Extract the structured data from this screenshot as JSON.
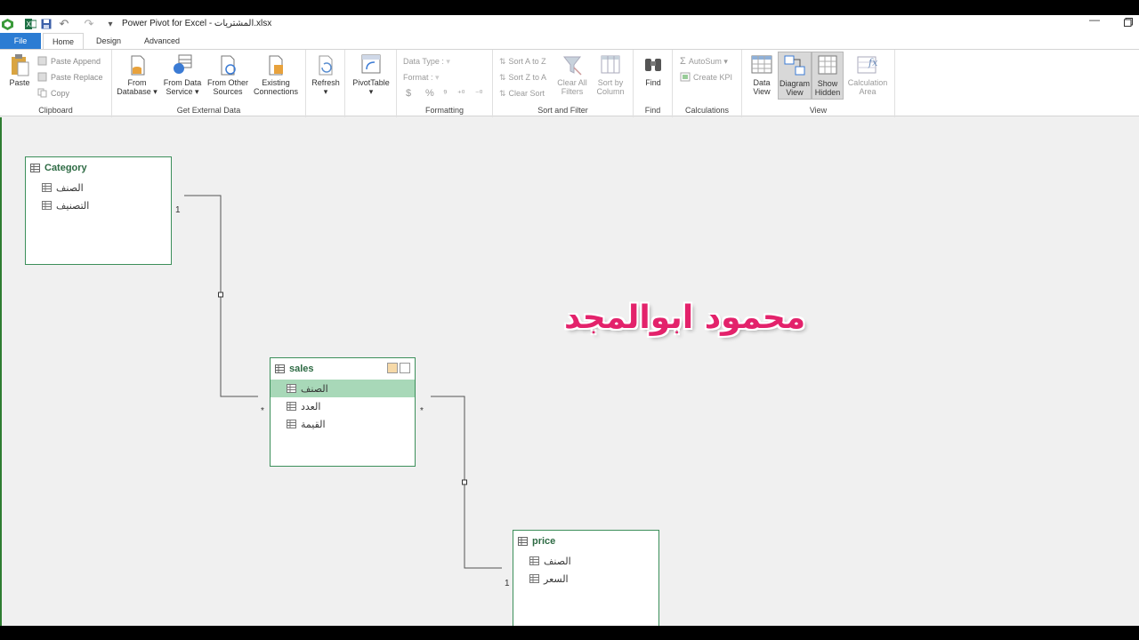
{
  "titlebar": {
    "title": "Power Pivot for Excel - المشتريات.xlsx",
    "qa_dropdown": "▾"
  },
  "tabs": {
    "file": "File",
    "home": "Home",
    "design": "Design",
    "advanced": "Advanced"
  },
  "ribbon": {
    "clipboard": {
      "label": "Clipboard",
      "paste": "Paste",
      "paste_append": "Paste Append",
      "paste_replace": "Paste Replace",
      "copy": "Copy"
    },
    "external": {
      "label": "Get External Data",
      "from_database_1": "From",
      "from_database_2": "Database",
      "from_data_service_1": "From Data",
      "from_data_service_2": "Service",
      "from_other_1": "From Other",
      "from_other_2": "Sources",
      "existing_1": "Existing",
      "existing_2": "Connections"
    },
    "refresh": {
      "label": "Refresh"
    },
    "pivot": {
      "label": "PivotTable"
    },
    "formatting": {
      "label": "Formatting",
      "data_type": "Data Type :",
      "format": "Format :",
      "symbols": [
        "$",
        "%",
        "⁹",
        "⁺⁰",
        "⁻⁰"
      ]
    },
    "sort": {
      "label": "Sort and Filter",
      "sort_az": "Sort A to Z",
      "sort_za": "Sort Z to A",
      "clear_sort": "Clear Sort",
      "clear_all_1": "Clear All",
      "clear_all_2": "Filters",
      "sort_col_1": "Sort by",
      "sort_col_2": "Column"
    },
    "find": {
      "label": "Find",
      "button": "Find"
    },
    "calculations": {
      "label": "Calculations",
      "autosum": "AutoSum",
      "create_kpi": "Create KPI"
    },
    "view": {
      "label": "View",
      "data_view_1": "Data",
      "data_view_2": "View",
      "diagram_1": "Diagram",
      "diagram_2": "View",
      "show_hidden_1": "Show",
      "show_hidden_2": "Hidden",
      "calc_area_1": "Calculation",
      "calc_area_2": "Area"
    }
  },
  "diagram": {
    "tables": {
      "category": {
        "name": "Category",
        "fields": [
          "الصنف",
          "التصنيف"
        ]
      },
      "sales": {
        "name": "sales",
        "fields": [
          "الصنف",
          "العدد",
          "القيمة"
        ],
        "selected_field": 0
      },
      "price": {
        "name": "price",
        "fields": [
          "الصنف",
          "السعر"
        ]
      }
    },
    "relations": {
      "cat_sales_one": "1",
      "cat_sales_many": "*",
      "sales_price_many": "*",
      "sales_price_one": "1"
    }
  },
  "watermark": "محمود ابوالمجد",
  "colors": {
    "accent": "#2b7cd3",
    "table_border": "#3c8f5a",
    "selected_field": "#a8d8b8",
    "watermark": "#e3226b"
  }
}
